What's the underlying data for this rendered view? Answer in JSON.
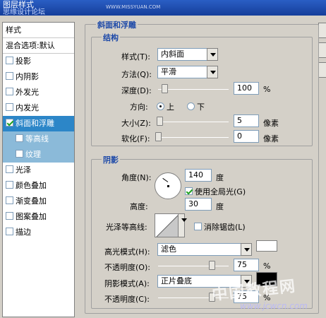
{
  "window": {
    "title": "图层样式",
    "subtitle": "思缘设计论坛",
    "watermark_top": "WWW.MISSYUAN.COM"
  },
  "left_panel": {
    "header": "样式",
    "items": [
      {
        "label": "混合选项:默认",
        "type": "plain"
      },
      {
        "label": "投影",
        "type": "check",
        "checked": false
      },
      {
        "label": "内阴影",
        "type": "check",
        "checked": false
      },
      {
        "label": "外发光",
        "type": "check",
        "checked": false
      },
      {
        "label": "内发光",
        "type": "check",
        "checked": false
      },
      {
        "label": "斜面和浮雕",
        "type": "check",
        "checked": true,
        "selected": true
      },
      {
        "label": "等高线",
        "type": "sub",
        "checked": false
      },
      {
        "label": "纹理",
        "type": "sub",
        "checked": false
      },
      {
        "label": "光泽",
        "type": "check",
        "checked": false
      },
      {
        "label": "颜色叠加",
        "type": "check",
        "checked": false
      },
      {
        "label": "渐变叠加",
        "type": "check",
        "checked": false
      },
      {
        "label": "图案叠加",
        "type": "check",
        "checked": false
      },
      {
        "label": "描边",
        "type": "check",
        "checked": false
      }
    ]
  },
  "bevel": {
    "title": "斜面和浮雕",
    "structure": {
      "title": "结构",
      "style_label": "样式(T):",
      "style_value": "内斜面",
      "technique_label": "方法(Q):",
      "technique_value": "平滑",
      "depth_label": "深度(D):",
      "depth_value": "100",
      "depth_unit": "%",
      "direction_label": "方向:",
      "direction_up": "上",
      "direction_down": "下",
      "size_label": "大小(Z):",
      "size_value": "5",
      "size_unit": "像素",
      "soften_label": "软化(F):",
      "soften_value": "0",
      "soften_unit": "像素"
    },
    "shading": {
      "title": "阴影",
      "angle_label": "角度(N):",
      "angle_value": "140",
      "angle_unit": "度",
      "global_light_label": "使用全局光(G)",
      "altitude_label": "高度:",
      "altitude_value": "30",
      "altitude_unit": "度",
      "gloss_contour_label": "光泽等高线:",
      "antialiased_label": "消除锯齿(L)",
      "highlight_mode_label": "高光模式(H):",
      "highlight_mode_value": "滤色",
      "highlight_opacity_label": "不透明度(O):",
      "highlight_opacity_value": "75",
      "highlight_opacity_unit": "%",
      "shadow_mode_label": "阴影模式(A):",
      "shadow_mode_value": "正片叠底",
      "shadow_opacity_label": "不透明度(C):",
      "shadow_opacity_value": "75",
      "shadow_opacity_unit": "%"
    }
  },
  "watermark": {
    "text": "中国教程网",
    "url": "www.jcwcn.com"
  },
  "colors": {
    "highlight": "#ffffff",
    "shadow": "#000000",
    "selected": "#2c86c8",
    "sub_item": "#8bbad9"
  }
}
